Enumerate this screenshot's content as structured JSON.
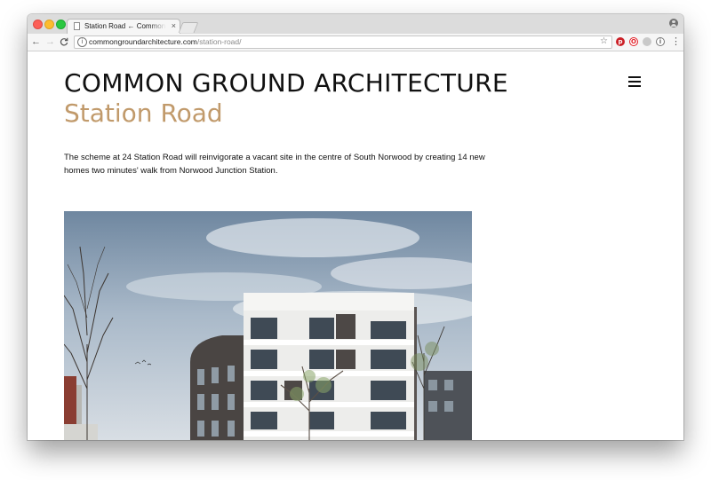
{
  "browser": {
    "tab": {
      "title": "Station Road ← Common Ground Architecture",
      "close": "×"
    },
    "nav": {
      "back": "←",
      "forward": "→",
      "reload": "C"
    },
    "address": {
      "host": "commongroundarchitecture.com",
      "path": "/station-road/"
    },
    "icons": [
      "info-icon",
      "bookmark-star-icon",
      "pinterest-icon",
      "opera-icon",
      "extension-icon",
      "info-extension-icon",
      "menu-dots-icon",
      "profile-icon"
    ]
  },
  "site": {
    "name": "COMMON GROUND ARCHITECTURE",
    "page_title": "Station Road",
    "intro": "The scheme at 24 Station Road will reinvigorate a vacant site in the centre of South Norwood by creating 14 new homes two minutes' walk from Norwood Junction Station.",
    "accent_color": "#c19a6b",
    "menu_icon": "hamburger-menu-icon"
  },
  "hero_image": {
    "subject": "architectural rendering of apartment building"
  }
}
